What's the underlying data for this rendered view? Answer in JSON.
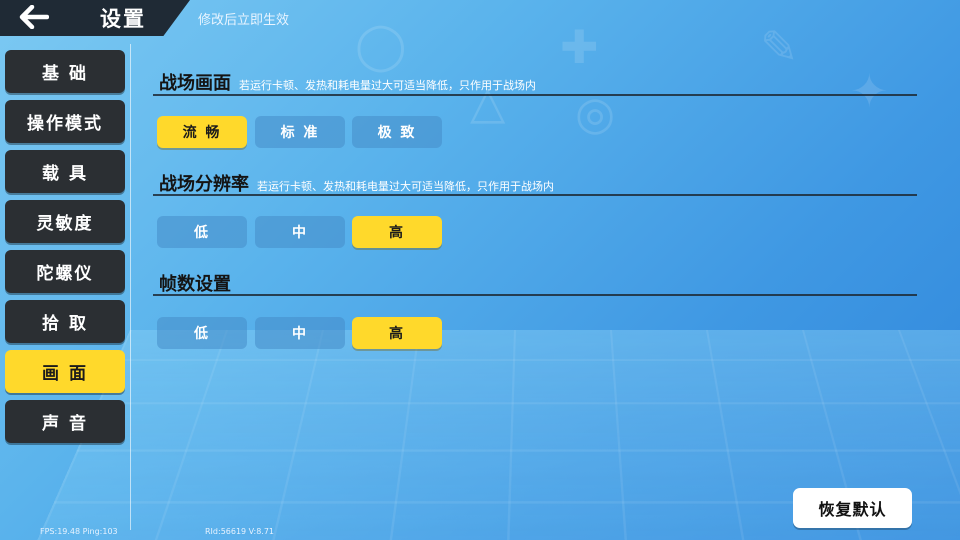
{
  "header": {
    "title": "设置",
    "subtitle": "修改后立即生效",
    "back_icon": "arrow-left-icon"
  },
  "sidebar": {
    "items": [
      {
        "label": "基 础"
      },
      {
        "label": "操作模式"
      },
      {
        "label": "载 具"
      },
      {
        "label": "灵敏度"
      },
      {
        "label": "陀螺仪"
      },
      {
        "label": "拾 取"
      },
      {
        "label": "画 面",
        "active": true
      },
      {
        "label": "声 音"
      }
    ]
  },
  "sections": [
    {
      "title": "战场画面",
      "hint": "若运行卡顿、发热和耗电量过大可适当降低，只作用于战场内",
      "options": [
        {
          "label": "流 畅",
          "selected": true
        },
        {
          "label": "标 准"
        },
        {
          "label": "极 致"
        }
      ]
    },
    {
      "title": "战场分辨率",
      "hint": "若运行卡顿、发热和耗电量过大可适当降低，只作用于战场内",
      "options": [
        {
          "label": "低"
        },
        {
          "label": "中"
        },
        {
          "label": "高",
          "selected": true
        }
      ]
    },
    {
      "title": "帧数设置",
      "hint": "",
      "options": [
        {
          "label": "低"
        },
        {
          "label": "中"
        },
        {
          "label": "高",
          "selected": true
        }
      ]
    }
  ],
  "reset_label": "恢复默认",
  "footer": {
    "fps": "FPS:19.48 Ping:103",
    "rid": "RId:56619 V:8.71"
  },
  "colors": {
    "accent": "#ffd92b",
    "dark": "#2b2f33",
    "bg": "#4aa6e8"
  }
}
